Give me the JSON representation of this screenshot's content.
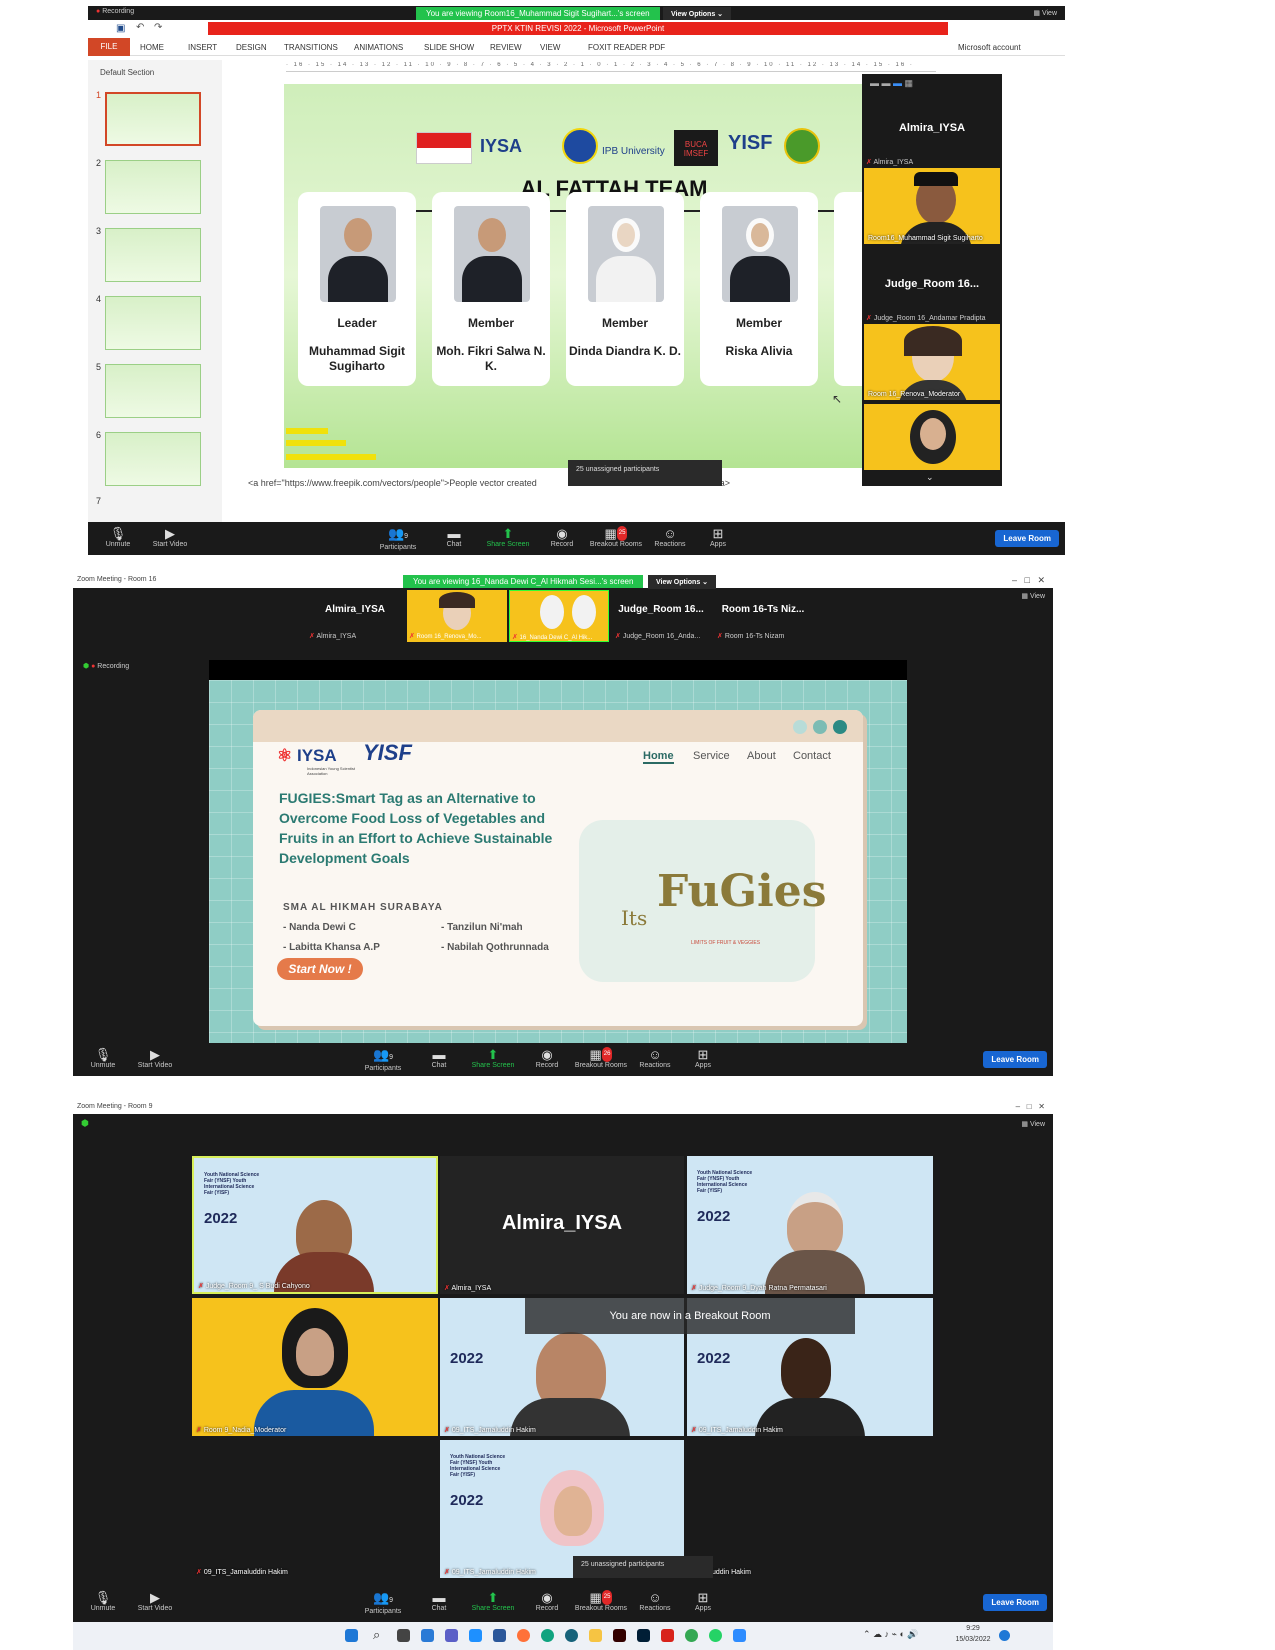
{
  "p1": {
    "banner": "You are viewing Room16_Muhammad Sigit Sugihart...'s screen",
    "view_options": "View Options ⌄",
    "recording": "Recording",
    "view": "View",
    "ppt_title": "PPTX KTIN REVISI 2022 - Microsoft PowerPoint",
    "account": "Microsoft account",
    "ribbon": [
      "FILE",
      "HOME",
      "INSERT",
      "DESIGN",
      "TRANSITIONS",
      "ANIMATIONS",
      "SLIDE SHOW",
      "REVIEW",
      "VIEW",
      "FOXIT READER PDF"
    ],
    "section": "Default Section",
    "thumbs": [
      "1",
      "2",
      "3",
      "4",
      "5",
      "6",
      "7"
    ],
    "slide": {
      "title": "AL FATTAH TEAM",
      "logos": [
        "IYSA",
        "IPB University",
        "BUCA IMSEF",
        "YISF"
      ],
      "members": [
        {
          "role": "Leader",
          "name": "Muhammad Sigit Sugiharto"
        },
        {
          "role": "Member",
          "name": "Moh. Fikri Salwa N. K."
        },
        {
          "role": "Member",
          "name": "Dinda Diandra K. D."
        },
        {
          "role": "Member",
          "name": "Riska Alivia"
        }
      ]
    },
    "notes": "<a href=\"https://www.freepik.com/vectors/people\">People vector created",
    "notes_end": "</a>",
    "unassigned": "25 unassigned participants",
    "gallery": {
      "t1": "Almira_IYSA",
      "t1_sub": "Almira_IYSA",
      "t2_lbl": "Room16_Muhammad Sigit Sugiharto",
      "t3": "Judge_Room 16...",
      "t3_sub": "Judge_Room 16_Andamar Pradipta",
      "t4_lbl": "Room 16_Renova_Moderator"
    },
    "toolbar": {
      "unmute": "Unmute",
      "video": "Start Video",
      "participants": "Participants",
      "participants_count": "9",
      "chat": "Chat",
      "share": "Share Screen",
      "record": "Record",
      "breakout": "Breakout Rooms",
      "breakout_badge": "25",
      "reactions": "Reactions",
      "apps": "Apps",
      "leave": "Leave Room"
    }
  },
  "p2": {
    "title": "Zoom Meeting - Room 16",
    "banner": "You are viewing 16_Nanda Dewi C_Al Hikmah Sesi...'s screen",
    "view_options": "View Options ⌄",
    "view": "View",
    "recording": "Recording",
    "strip": [
      {
        "type": "text",
        "big": "Almira_IYSA",
        "sub": "Almira_IYSA"
      },
      {
        "type": "video",
        "sub": "Room 16_Renova_Mo..."
      },
      {
        "type": "video",
        "sub": "16_Nanda Dewi C_Al Hik..."
      },
      {
        "type": "text",
        "big": "Judge_Room 16...",
        "sub": "Judge_Room 16_Anda..."
      },
      {
        "type": "text",
        "big": "Room 16-Ts Niz...",
        "sub": "Room 16-Ts Nizam"
      }
    ],
    "slide": {
      "nav": [
        "Home",
        "Service",
        "About",
        "Contact"
      ],
      "logo": "IYSA",
      "logo_sub": "Indonesian Young Scientist Association",
      "yisf": "YISF",
      "title": "FUGIES:Smart Tag as an Alternative to Overcome Food Loss of Vegetables and Fruits in an Effort to Achieve Sustainable Development Goals",
      "school": "SMA AL HIKMAH SURABAYA",
      "names": [
        "- Nanda Dewi C",
        "- Tanzilun Ni'mah",
        "- Labitta Khansa A.P",
        "- Nabilah Qothrunnada"
      ],
      "cta": "Start Now !",
      "brand_a": "Its",
      "brand_b": "FuGies",
      "brand_tag": "LIMITS OF FRUIT & VEGGIES"
    },
    "toolbar": {
      "unmute": "Unmute",
      "video": "Start Video",
      "participants": "Participants",
      "participants_count": "9",
      "chat": "Chat",
      "share": "Share Screen",
      "record": "Record",
      "breakout": "Breakout Rooms",
      "breakout_badge": "26",
      "reactions": "Reactions",
      "apps": "Apps",
      "leave": "Leave Room"
    }
  },
  "p3": {
    "title": "Zoom Meeting - Room 9",
    "view": "View",
    "tiles": [
      {
        "label": "Judge_Room 9_ S Budi Cahyono"
      },
      {
        "big": "Almira_IYSA",
        "label": "Almira_IYSA"
      },
      {
        "label": "Judge_Room 9_Dyah Ratna Permatasari"
      },
      {
        "label": "Room 9_Nadia_Moderator"
      },
      {
        "label": "09_ITS_Jamaluddin Hakim"
      },
      {
        "label": "09_ITS_Jamaluddin Hakim"
      },
      {
        "label": "09_ITS_Jamaluddin Hakim"
      },
      {
        "label": "09_ITS_Jamaluddin Hakim"
      },
      {
        "label": "...amaluddin Hakim"
      }
    ],
    "tile_year": "2022",
    "tile_text": "Youth National Science Fair (YNSF) Youth International Science Fair (YISF)",
    "breakout_msg": "You are now in a Breakout Room",
    "unassigned": "25 unassigned participants",
    "toolbar": {
      "unmute": "Unmute",
      "video": "Start Video",
      "participants": "Participants",
      "participants_count": "9",
      "chat": "Chat",
      "share": "Share Screen",
      "record": "Record",
      "breakout": "Breakout Rooms",
      "breakout_badge": "25",
      "reactions": "Reactions",
      "apps": "Apps",
      "leave": "Leave Room"
    }
  },
  "taskbar": {
    "time": "9:29",
    "date": "15/03/2022"
  }
}
